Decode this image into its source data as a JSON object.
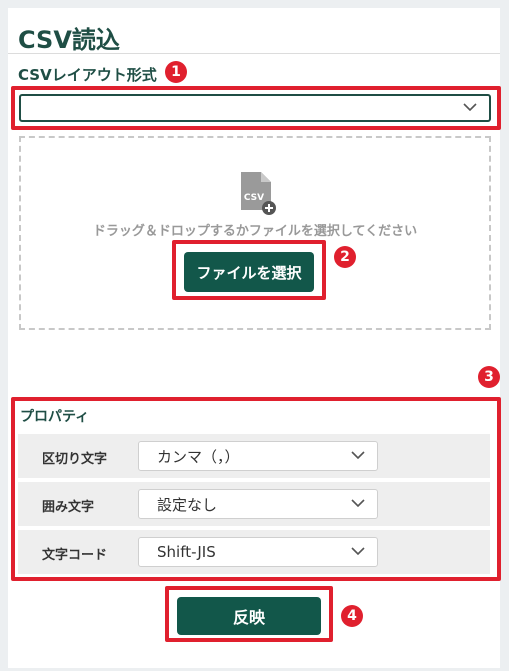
{
  "panel": {
    "title": "CSV読込"
  },
  "layout_section": {
    "label": "CSVレイアウト形式",
    "badge": "1",
    "select_value": ""
  },
  "dropzone": {
    "file_icon_text": "CSV",
    "instruction": "ドラッグ＆ドロップするかファイルを選択してください",
    "select_button_label": "ファイルを選択",
    "badge": "2"
  },
  "properties": {
    "label": "プロパティ",
    "badge": "3",
    "rows": [
      {
        "label": "区切り文字",
        "value": "カンマ（，）"
      },
      {
        "label": "囲み文字",
        "value": "設定なし"
      },
      {
        "label": "文字コード",
        "value": "Shift-JIS"
      }
    ]
  },
  "apply": {
    "button_label": "反映",
    "badge": "4"
  },
  "colors": {
    "brand_green": "#12574a",
    "title_green": "#1f4e45",
    "highlight_red": "#e0202e"
  }
}
